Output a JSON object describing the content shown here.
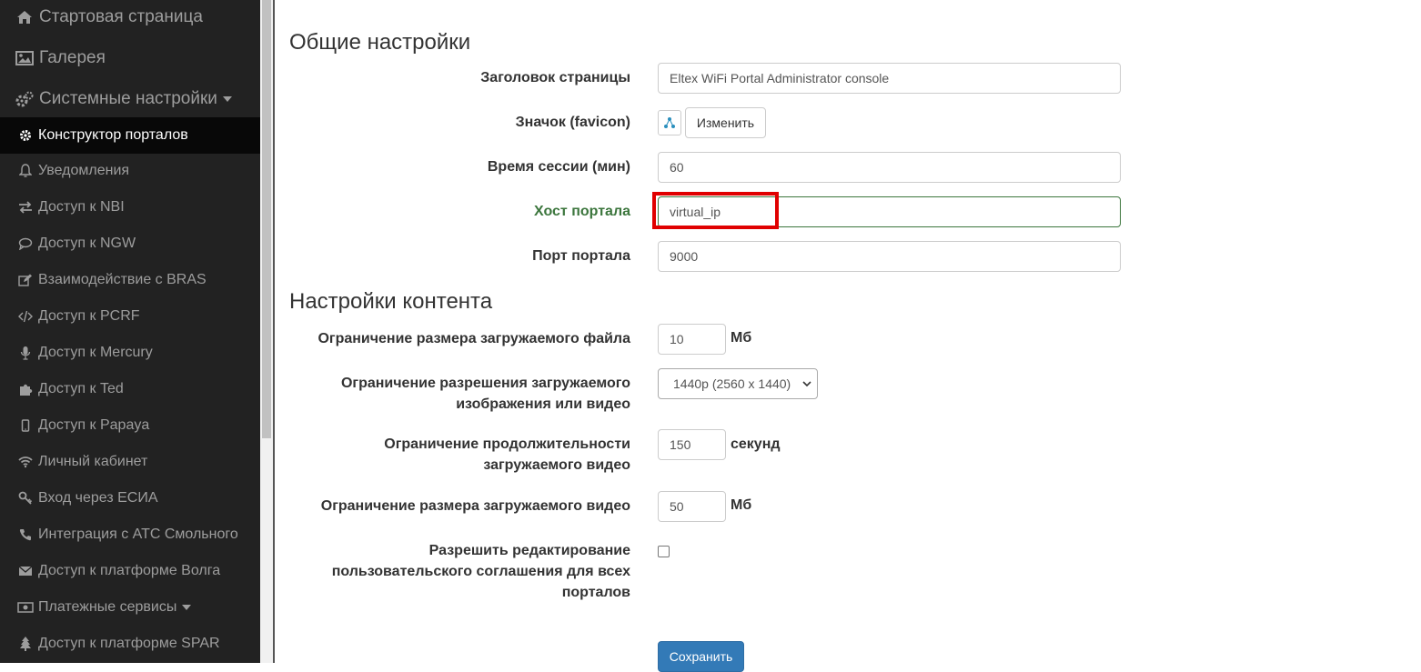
{
  "sidebar": {
    "items": [
      {
        "label": "Стартовая страница",
        "icon": "home-icon"
      },
      {
        "label": "Галерея",
        "icon": "image-icon"
      },
      {
        "label": "Системные настройки",
        "icon": "cogs-icon"
      },
      {
        "label": "Конструктор порталов",
        "icon": "gear-icon"
      },
      {
        "label": "Уведомления",
        "icon": "bell-icon"
      },
      {
        "label": "Доступ к NBI",
        "icon": "exchange-icon"
      },
      {
        "label": "Доступ к NGW",
        "icon": "comment-icon"
      },
      {
        "label": "Взаимодействие с BRAS",
        "icon": "edit-icon"
      },
      {
        "label": "Доступ к PCRF",
        "icon": "code-icon"
      },
      {
        "label": "Доступ к Mercury",
        "icon": "microphone-icon"
      },
      {
        "label": "Доступ к Ted",
        "icon": "puzzle-icon"
      },
      {
        "label": "Доступ к Papaya",
        "icon": "mobile-icon"
      },
      {
        "label": "Личный кабинет",
        "icon": "wifi-icon"
      },
      {
        "label": "Вход через ЕСИА",
        "icon": "key-icon"
      },
      {
        "label": "Интеграция с АТС Смольного",
        "icon": "phone-icon"
      },
      {
        "label": "Доступ к платформе Волга",
        "icon": "envelope-icon"
      },
      {
        "label": "Платежные сервисы",
        "icon": "money-icon"
      },
      {
        "label": "Доступ к платформе SPAR",
        "icon": "tree-icon"
      }
    ]
  },
  "general": {
    "title": "Общие настройки",
    "page_title_label": "Заголовок страницы",
    "page_title_value": "Eltex WiFi Portal Administrator console",
    "favicon_label": "Значок (favicon)",
    "favicon_button": "Изменить",
    "session_label": "Время сессии (мин)",
    "session_value": "60",
    "host_label": "Хост портала",
    "host_value": "virtual_ip",
    "port_label": "Порт портала",
    "port_value": "9000"
  },
  "content": {
    "title": "Настройки контента",
    "file_size_label": "Ограничение размера загружаемого файла",
    "file_size_value": "10",
    "file_size_unit": "Мб",
    "resolution_label_1": "Ограничение разрешения загружаемого",
    "resolution_label_2": "изображения или видео",
    "resolution_value": "1440p (2560 x 1440)",
    "duration_label_1": "Ограничение продолжительности",
    "duration_label_2": "загружаемого видео",
    "duration_value": "150",
    "duration_unit": "секунд",
    "video_size_label": "Ограничение размера загружаемого видео",
    "video_size_value": "50",
    "video_size_unit": "Мб",
    "agreement_label_1": "Разрешить редактирование",
    "agreement_label_2": "пользовательского соглашения для всех",
    "agreement_label_3": "порталов",
    "agreement_checked": false,
    "save_button": "Сохранить"
  },
  "colors": {
    "sidebar_bg": "#222222",
    "active_bg": "#080808",
    "primary": "#337ab7",
    "success": "#3c763d",
    "highlight": "#e00000"
  }
}
